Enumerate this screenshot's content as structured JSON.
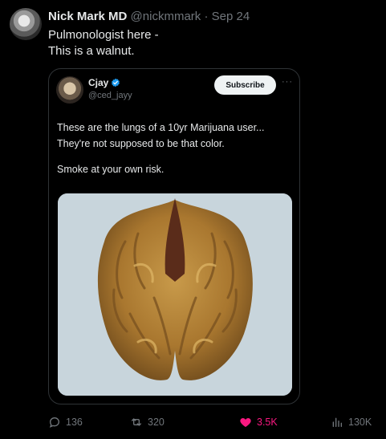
{
  "tweet": {
    "author_name": "Nick Mark MD",
    "handle": "@nickmmark",
    "separator": "·",
    "date": "Sep 24",
    "text_line1": "Pulmonologist here -",
    "text_line2": "This is a walnut."
  },
  "quoted": {
    "author_name": "Cjay",
    "handle": "@ced_jayy",
    "subscribe_label": "Subscribe",
    "more": "···",
    "line1": "These are the lungs of a 10yr Marijuana user...",
    "line2": "They're not supposed to be that color.",
    "line3": "Smoke at your own risk."
  },
  "actions": {
    "replies": "136",
    "reposts": "320",
    "likes": "3.5K",
    "views": "130K"
  },
  "colors": {
    "background": "#000000",
    "verified": "#1d9bf0",
    "like": "#f91880",
    "muted": "#71767b"
  }
}
